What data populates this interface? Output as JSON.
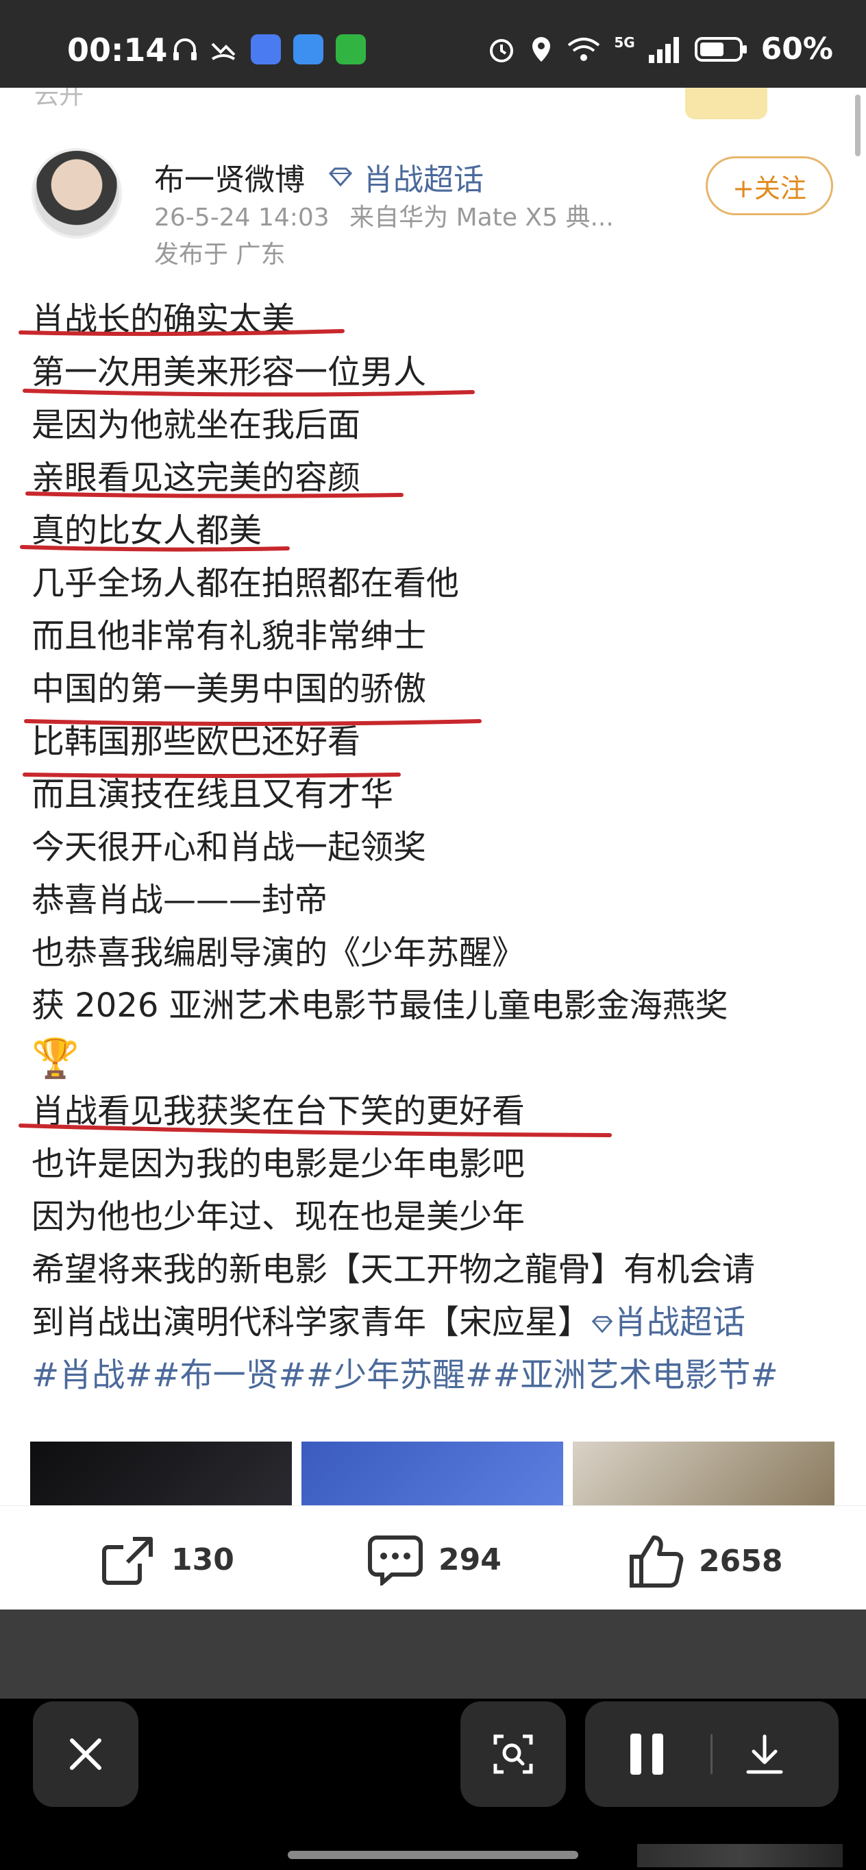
{
  "status_bar": {
    "time": "00:14",
    "network": "5G",
    "battery": "60%"
  },
  "post": {
    "top_strip_text": "云开",
    "author": "布一贤微博",
    "super_topic": "肖战超话",
    "timestamp": "26-5-24 14:03",
    "source": "来自华为 Mate X5 典...",
    "location": "发布于 广东",
    "follow_label": "+关注",
    "lines": [
      "肖战长的确实太美",
      "第一次用美来形容一位男人",
      "是因为他就坐在我后面",
      "亲眼看见这完美的容颜",
      "真的比女人都美",
      "几乎全场人都在拍照都在看他",
      "而且他非常有礼貌非常绅士",
      "中国的第一美男中国的骄傲",
      "比韩国那些欧巴还好看",
      "而且演技在线且又有才华",
      "今天很开心和肖战一起领奖",
      "恭喜肖战———封帝",
      "也恭喜我编剧导演的《少年苏醒》",
      "获 2026 亚洲艺术电影节最佳儿童电影金海燕奖"
    ],
    "trophy": "🏆",
    "lines_after": [
      "肖战看见我获奖在台下笑的更好看",
      "也许是因为我的电影是少年电影吧",
      "因为他也少年过、现在也是美少年",
      "希望将来我的新电影【天工开物之龍骨】有机会请"
    ],
    "last_line_prefix": "到肖战出演明代科学家青年【宋应星】",
    "last_line_link": "肖战超话",
    "hashtags": "#肖战##布一贤##少年苏醒##亚洲艺术电影节#"
  },
  "actions": {
    "share_count": "130",
    "comment_count": "294",
    "like_count": "2658"
  },
  "colors": {
    "link": "#4b6a9b",
    "follow": "#e08a1e",
    "underline": "#c8282d"
  }
}
